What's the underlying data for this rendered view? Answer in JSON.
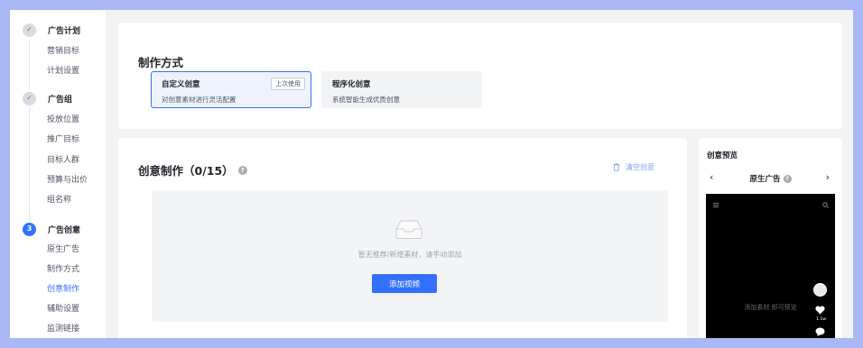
{
  "sidebar": {
    "steps": [
      {
        "indicator": "✓",
        "title": "广告计划",
        "items": [
          "营销目标",
          "计划设置"
        ]
      },
      {
        "indicator": "✓",
        "title": "广告组",
        "items": [
          "投放位置",
          "推广目标",
          "目标人群",
          "预算与出价",
          "组名称"
        ]
      },
      {
        "indicator": "3",
        "title": "广告创意",
        "items": [
          "原生广告",
          "制作方式",
          "创意制作",
          "辅助设置",
          "监测链接"
        ]
      }
    ]
  },
  "method": {
    "title": "制作方式",
    "options": [
      {
        "title": "自定义创意",
        "desc": "对创意素材进行灵活配置",
        "badge": "上次使用"
      },
      {
        "title": "程序化创意",
        "desc": "系统智能生成优质创意"
      }
    ]
  },
  "creative": {
    "title": "创意制作（0/15）",
    "clear_label": "清空创意",
    "empty_text": "暂无推荐/新增素材，请手动添加",
    "add_button": "添加视频"
  },
  "preview": {
    "title": "创意预览",
    "nav_label": "原生广告",
    "phone_text": "添加素材 即可预览",
    "like_count": "1.1w"
  },
  "colors": {
    "accent": "#3370ff",
    "frame": "#a9b8f4"
  }
}
